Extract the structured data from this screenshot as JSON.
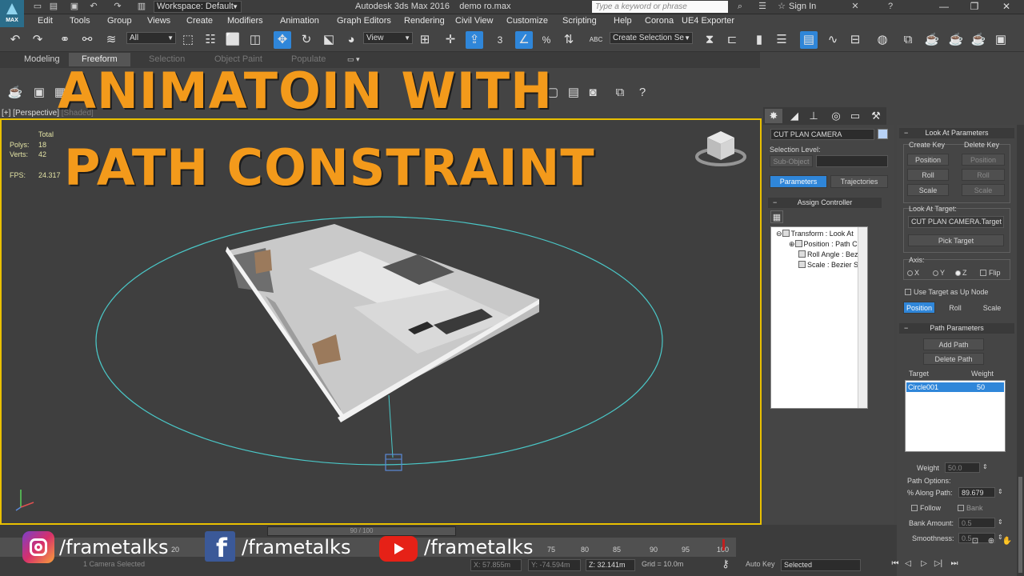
{
  "app": {
    "title": "Autodesk 3ds Max 2016",
    "file": "demo ro.max",
    "logo_text": "MAX",
    "workspace": "Workspace: Default",
    "search_placeholder": "Type a keyword or phrase",
    "sign_in": "Sign In"
  },
  "menu": [
    "Edit",
    "Tools",
    "Group",
    "Views",
    "Create",
    "Modifiers",
    "Animation",
    "Graph Editors",
    "Rendering",
    "Civil View",
    "Customize",
    "Scripting",
    "Help",
    "Corona",
    "UE4 Exporter"
  ],
  "toolbar": {
    "filter": "All",
    "coord": "View",
    "selection_set": "Create Selection Se",
    "snap_label": "3",
    "percent_label": "%",
    "abc_label": "ABC"
  },
  "ribbon": {
    "tabs": [
      "Modeling",
      "Freeform",
      "Selection",
      "Object Paint",
      "Populate"
    ],
    "selected": "Freeform"
  },
  "viewport": {
    "label_a": "[+] [Perspective]",
    "label_b": "[Shaded]",
    "stats": {
      "total_label": "Total",
      "polys_label": "Polys:",
      "polys": "18",
      "verts_label": "Verts:",
      "verts": "42",
      "fps_label": "FPS:",
      "fps": "24.317"
    }
  },
  "headline": {
    "line1": "ANIMATOIN WITH",
    "line2": "PATH CONSTRAINT"
  },
  "command_panel": {
    "object_name": "CUT PLAN CAMERA",
    "selection_level_label": "Selection Level:",
    "sub_object": "Sub-Object",
    "tabs": [
      "Parameters",
      "Trajectories"
    ],
    "assign_controller": "Assign Controller",
    "tree": [
      "Transform : Look At",
      "Position : Path Co",
      "Roll Angle : Bezie",
      "Scale : Bezier Sca"
    ]
  },
  "look_at": {
    "rollout": "Look At Parameters",
    "create_key": "Create Key",
    "delete_key": "Delete Key",
    "position": "Position",
    "roll": "Roll",
    "scale": "Scale",
    "target_label": "Look At Target:",
    "target": "CUT PLAN CAMERA.Target",
    "pick_target": "Pick Target",
    "axis_label": "Axis:",
    "x": "X",
    "y": "Y",
    "z": "Z",
    "flip": "Flip",
    "up_node": "Use Target as Up Node"
  },
  "path_params": {
    "rollout": "Path Parameters",
    "add_path": "Add Path",
    "delete_path": "Delete Path",
    "target_col": "Target",
    "weight_col": "Weight",
    "targets": [
      {
        "name": "Circle001",
        "weight": "50"
      }
    ],
    "weight_label": "Weight",
    "weight": "50.0",
    "options_label": "Path Options:",
    "along_label": "% Along Path:",
    "along": "89.679",
    "follow": "Follow",
    "bank": "Bank",
    "bank_amount_label": "Bank Amount:",
    "bank_amount": "0.5",
    "smoothness_label": "Smoothness:",
    "smoothness": "0.5"
  },
  "timeline": {
    "slider": "90 / 100",
    "ticks": [
      "20",
      "75",
      "80",
      "85",
      "90",
      "95",
      "100"
    ]
  },
  "status": {
    "selected_info": "1 Camera Selected",
    "x": "X: 57.855m",
    "y": "Y: -74.594m",
    "z": "Z: 32.141m",
    "grid": "Grid = 10.0m",
    "auto_key": "Auto Key",
    "selected": "Selected"
  },
  "social": [
    {
      "network": "instagram-icon",
      "handle": "/frametalks"
    },
    {
      "network": "facebook-icon",
      "handle": "/frametalks"
    },
    {
      "network": "youtube-icon",
      "handle": "/frametalks"
    }
  ],
  "colors": {
    "headline": "#f39a1b",
    "accent": "#2f86d9",
    "viewport_border": "#e9c000",
    "path": "#4ac8c8"
  }
}
